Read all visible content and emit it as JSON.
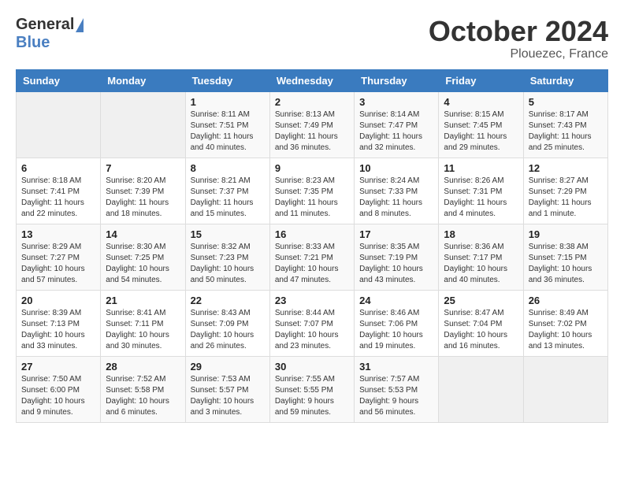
{
  "header": {
    "logo_general": "General",
    "logo_blue": "Blue",
    "month_title": "October 2024",
    "location": "Plouezec, France"
  },
  "weekdays": [
    "Sunday",
    "Monday",
    "Tuesday",
    "Wednesday",
    "Thursday",
    "Friday",
    "Saturday"
  ],
  "weeks": [
    [
      {
        "day": "",
        "info": ""
      },
      {
        "day": "",
        "info": ""
      },
      {
        "day": "1",
        "info": "Sunrise: 8:11 AM\nSunset: 7:51 PM\nDaylight: 11 hours and 40 minutes."
      },
      {
        "day": "2",
        "info": "Sunrise: 8:13 AM\nSunset: 7:49 PM\nDaylight: 11 hours and 36 minutes."
      },
      {
        "day": "3",
        "info": "Sunrise: 8:14 AM\nSunset: 7:47 PM\nDaylight: 11 hours and 32 minutes."
      },
      {
        "day": "4",
        "info": "Sunrise: 8:15 AM\nSunset: 7:45 PM\nDaylight: 11 hours and 29 minutes."
      },
      {
        "day": "5",
        "info": "Sunrise: 8:17 AM\nSunset: 7:43 PM\nDaylight: 11 hours and 25 minutes."
      }
    ],
    [
      {
        "day": "6",
        "info": "Sunrise: 8:18 AM\nSunset: 7:41 PM\nDaylight: 11 hours and 22 minutes."
      },
      {
        "day": "7",
        "info": "Sunrise: 8:20 AM\nSunset: 7:39 PM\nDaylight: 11 hours and 18 minutes."
      },
      {
        "day": "8",
        "info": "Sunrise: 8:21 AM\nSunset: 7:37 PM\nDaylight: 11 hours and 15 minutes."
      },
      {
        "day": "9",
        "info": "Sunrise: 8:23 AM\nSunset: 7:35 PM\nDaylight: 11 hours and 11 minutes."
      },
      {
        "day": "10",
        "info": "Sunrise: 8:24 AM\nSunset: 7:33 PM\nDaylight: 11 hours and 8 minutes."
      },
      {
        "day": "11",
        "info": "Sunrise: 8:26 AM\nSunset: 7:31 PM\nDaylight: 11 hours and 4 minutes."
      },
      {
        "day": "12",
        "info": "Sunrise: 8:27 AM\nSunset: 7:29 PM\nDaylight: 11 hours and 1 minute."
      }
    ],
    [
      {
        "day": "13",
        "info": "Sunrise: 8:29 AM\nSunset: 7:27 PM\nDaylight: 10 hours and 57 minutes."
      },
      {
        "day": "14",
        "info": "Sunrise: 8:30 AM\nSunset: 7:25 PM\nDaylight: 10 hours and 54 minutes."
      },
      {
        "day": "15",
        "info": "Sunrise: 8:32 AM\nSunset: 7:23 PM\nDaylight: 10 hours and 50 minutes."
      },
      {
        "day": "16",
        "info": "Sunrise: 8:33 AM\nSunset: 7:21 PM\nDaylight: 10 hours and 47 minutes."
      },
      {
        "day": "17",
        "info": "Sunrise: 8:35 AM\nSunset: 7:19 PM\nDaylight: 10 hours and 43 minutes."
      },
      {
        "day": "18",
        "info": "Sunrise: 8:36 AM\nSunset: 7:17 PM\nDaylight: 10 hours and 40 minutes."
      },
      {
        "day": "19",
        "info": "Sunrise: 8:38 AM\nSunset: 7:15 PM\nDaylight: 10 hours and 36 minutes."
      }
    ],
    [
      {
        "day": "20",
        "info": "Sunrise: 8:39 AM\nSunset: 7:13 PM\nDaylight: 10 hours and 33 minutes."
      },
      {
        "day": "21",
        "info": "Sunrise: 8:41 AM\nSunset: 7:11 PM\nDaylight: 10 hours and 30 minutes."
      },
      {
        "day": "22",
        "info": "Sunrise: 8:43 AM\nSunset: 7:09 PM\nDaylight: 10 hours and 26 minutes."
      },
      {
        "day": "23",
        "info": "Sunrise: 8:44 AM\nSunset: 7:07 PM\nDaylight: 10 hours and 23 minutes."
      },
      {
        "day": "24",
        "info": "Sunrise: 8:46 AM\nSunset: 7:06 PM\nDaylight: 10 hours and 19 minutes."
      },
      {
        "day": "25",
        "info": "Sunrise: 8:47 AM\nSunset: 7:04 PM\nDaylight: 10 hours and 16 minutes."
      },
      {
        "day": "26",
        "info": "Sunrise: 8:49 AM\nSunset: 7:02 PM\nDaylight: 10 hours and 13 minutes."
      }
    ],
    [
      {
        "day": "27",
        "info": "Sunrise: 7:50 AM\nSunset: 6:00 PM\nDaylight: 10 hours and 9 minutes."
      },
      {
        "day": "28",
        "info": "Sunrise: 7:52 AM\nSunset: 5:58 PM\nDaylight: 10 hours and 6 minutes."
      },
      {
        "day": "29",
        "info": "Sunrise: 7:53 AM\nSunset: 5:57 PM\nDaylight: 10 hours and 3 minutes."
      },
      {
        "day": "30",
        "info": "Sunrise: 7:55 AM\nSunset: 5:55 PM\nDaylight: 9 hours and 59 minutes."
      },
      {
        "day": "31",
        "info": "Sunrise: 7:57 AM\nSunset: 5:53 PM\nDaylight: 9 hours and 56 minutes."
      },
      {
        "day": "",
        "info": ""
      },
      {
        "day": "",
        "info": ""
      }
    ]
  ]
}
